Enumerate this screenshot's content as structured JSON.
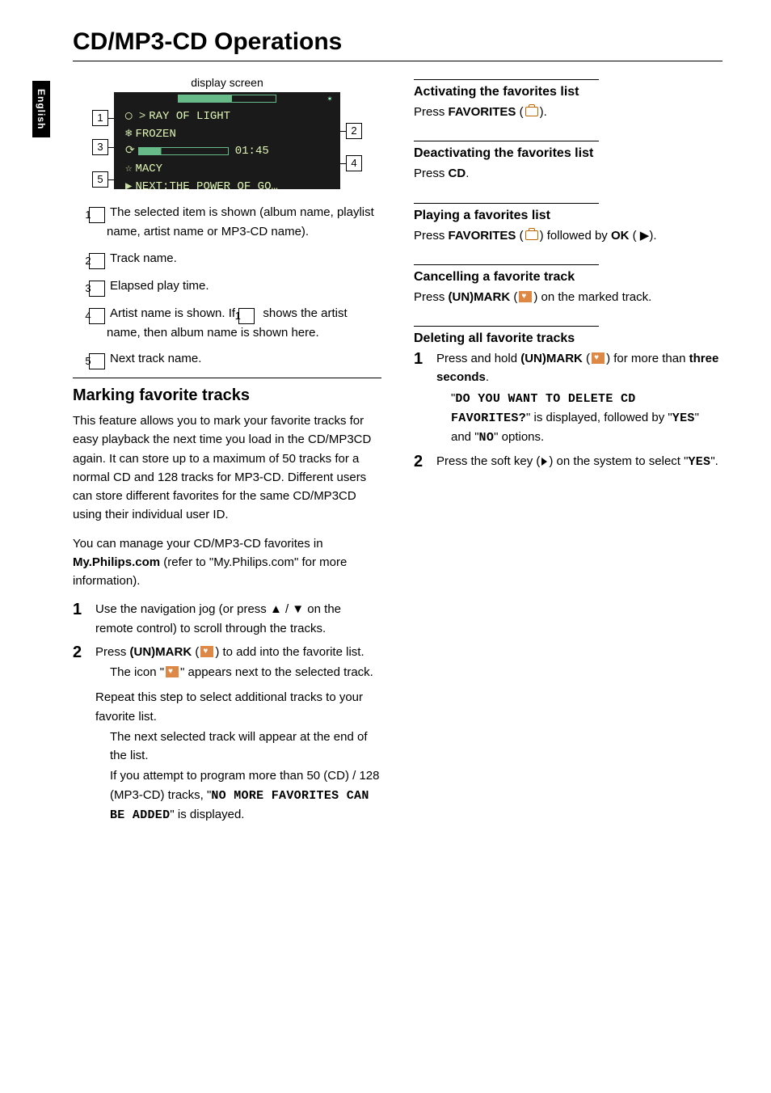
{
  "sidetab": "English",
  "title": "CD/MP3-CD Operations",
  "display": {
    "caption": "display screen",
    "row1": "RAY OF LIGHT",
    "row2": "FROZEN",
    "time": "01:45",
    "row4": "MACY",
    "row5": "NEXT:THE POWER OF GO…",
    "row1_prefix": "◯ >",
    "row2_prefix": "❄",
    "row4_prefix": "☆",
    "row5_prefix": "▶"
  },
  "callouts": {
    "c1": "1",
    "c2": "2",
    "c3": "3",
    "c4": "4",
    "c5": "5"
  },
  "legend": [
    {
      "n": "1",
      "text_a": "The selected item is shown (album name, playlist name, artist name or MP3-CD name)."
    },
    {
      "n": "2",
      "text_a": "Track name."
    },
    {
      "n": "3",
      "text_a": "Elapsed play time."
    },
    {
      "n": "4",
      "text_a": "Artist name is shown.  If ",
      "text_b": " shows the artist name, then album name is shown here."
    },
    {
      "n": "5",
      "text_a": "Next track name."
    }
  ],
  "marking": {
    "heading": "Marking favorite tracks",
    "p1a": "This feature allows you to mark your favorite tracks for easy playback the next time you load in the CD/MP3CD again.  It can store up to a maximum of 50 tracks for a normal CD and 128 tracks for MP3-CD.  Different users can store different favorites for the same CD/MP3CD using their individual user ID.",
    "p2a": "You can manage your CD/MP3-CD favorites in ",
    "p2b": "My.Philips.com",
    "p2c": " (refer to \"My.Philips.com\" for more information).",
    "s1": "Use the navigation jog (or press ▲ / ▼ on the remote control) to scroll through the tracks.",
    "s2a": "Press ",
    "s2b": "(UN)MARK",
    "s2c": " (",
    "s2d": ") to add into the favorite list.",
    "s2_ind1a": "The icon \"",
    "s2_ind1b": "\" appears next to the selected track.",
    "s2_p1": "Repeat this step to select additional tracks to your favorite list.",
    "s2_ind2": "The next selected track will appear at the end of the list.",
    "s2_ind3a": "If you attempt to program more than 50 (CD) / 128 (MP3-CD) tracks, \"",
    "s2_ind3b": "NO MORE FAVORITES CAN BE ADDED",
    "s2_ind3c": "\" is displayed."
  },
  "right": {
    "act_h": "Activating the favorites list",
    "act_p_a": "Press ",
    "act_p_b": "FAVORITES",
    "act_p_c": " (",
    "act_p_d": ").",
    "deact_h": "Deactivating the favorites list",
    "deact_p_a": "Press ",
    "deact_p_b": "CD",
    "deact_p_c": ".",
    "play_h": "Playing a favorites list",
    "play_p_a": "Press ",
    "play_p_b": "FAVORITES",
    "play_p_c": " (",
    "play_p_d": ") followed by ",
    "play_p_e": "OK",
    "play_p_f": " ( ▶).",
    "cancel_h": "Cancelling a favorite track",
    "cancel_p_a": "Press ",
    "cancel_p_b": "(UN)MARK",
    "cancel_p_c": " (",
    "cancel_p_d": ") on the marked track.",
    "del_h": "Deleting all favorite tracks",
    "del_s1_a": "Press and hold ",
    "del_s1_b": "(UN)MARK",
    "del_s1_c": " (",
    "del_s1_d": ") for more than ",
    "del_s1_e": "three seconds",
    "del_s1_f": ".",
    "del_s1_ind_a": "\"",
    "del_s1_ind_b": "DO YOU WANT TO DELETE CD FAVORITES?",
    "del_s1_ind_c": "\" is displayed, followed by \"",
    "del_s1_ind_d": "YES",
    "del_s1_ind_e": "\" and \"",
    "del_s1_ind_f": "NO",
    "del_s1_ind_g": "\" options.",
    "del_s2_a": "Press the soft key (",
    "del_s2_b": ") on the system to select \"",
    "del_s2_c": "YES",
    "del_s2_d": "\"."
  },
  "nums": {
    "one": "1",
    "two": "2"
  }
}
